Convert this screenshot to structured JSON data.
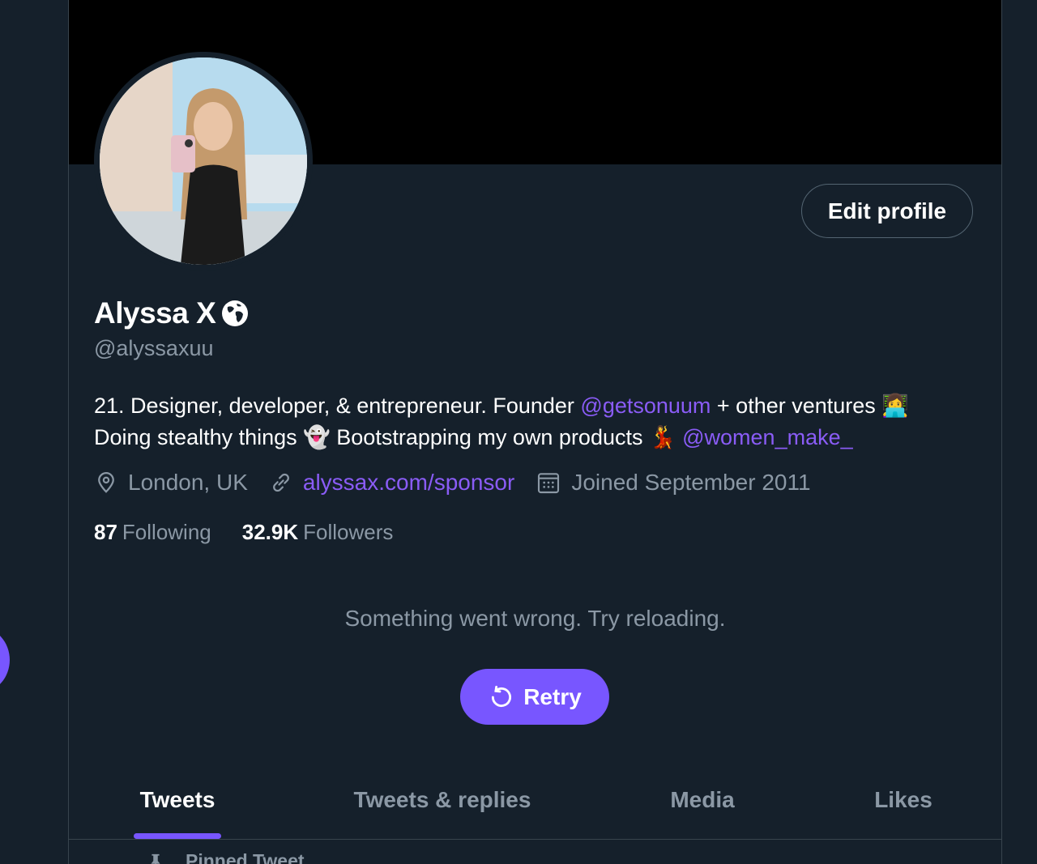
{
  "profile": {
    "name": "Alyssa X",
    "handle": "@alyssaxuu",
    "edit_profile_label": "Edit profile",
    "bio": {
      "part1": "21. Designer, developer, & entrepreneur. Founder ",
      "mention1": "@getsonuum",
      "part2": " + other ventures ",
      "emoji1": "👩‍💻",
      "part3": "Doing stealthy things ",
      "emoji2": "👻",
      "part4": " Bootstrapping my own products ",
      "emoji3": "💃",
      "mention2": "@women_make_"
    },
    "location": "London, UK",
    "website": "alyssax.com/sponsor",
    "joined": "Joined September 2011",
    "following_count": "87",
    "following_label": "Following",
    "followers_count": "32.9K",
    "followers_label": "Followers"
  },
  "error": {
    "message": "Something went wrong. Try reloading.",
    "retry_label": "Retry"
  },
  "tabs": [
    {
      "label": "Tweets",
      "active": true
    },
    {
      "label": "Tweets & replies",
      "active": false
    },
    {
      "label": "Media",
      "active": false
    },
    {
      "label": "Likes",
      "active": false
    }
  ],
  "pinned_label": "Pinned Tweet",
  "colors": {
    "background": "#15202b",
    "accent": "#7856ff",
    "link": "#8a5cf6",
    "secondary_text": "#8b98a5",
    "banner": "#000000"
  },
  "icons": {
    "location": "location-pin-icon",
    "website": "link-icon",
    "joined": "calendar-icon",
    "retry": "refresh-icon",
    "name_badge": "globe-icon",
    "pinned": "pin-icon"
  }
}
